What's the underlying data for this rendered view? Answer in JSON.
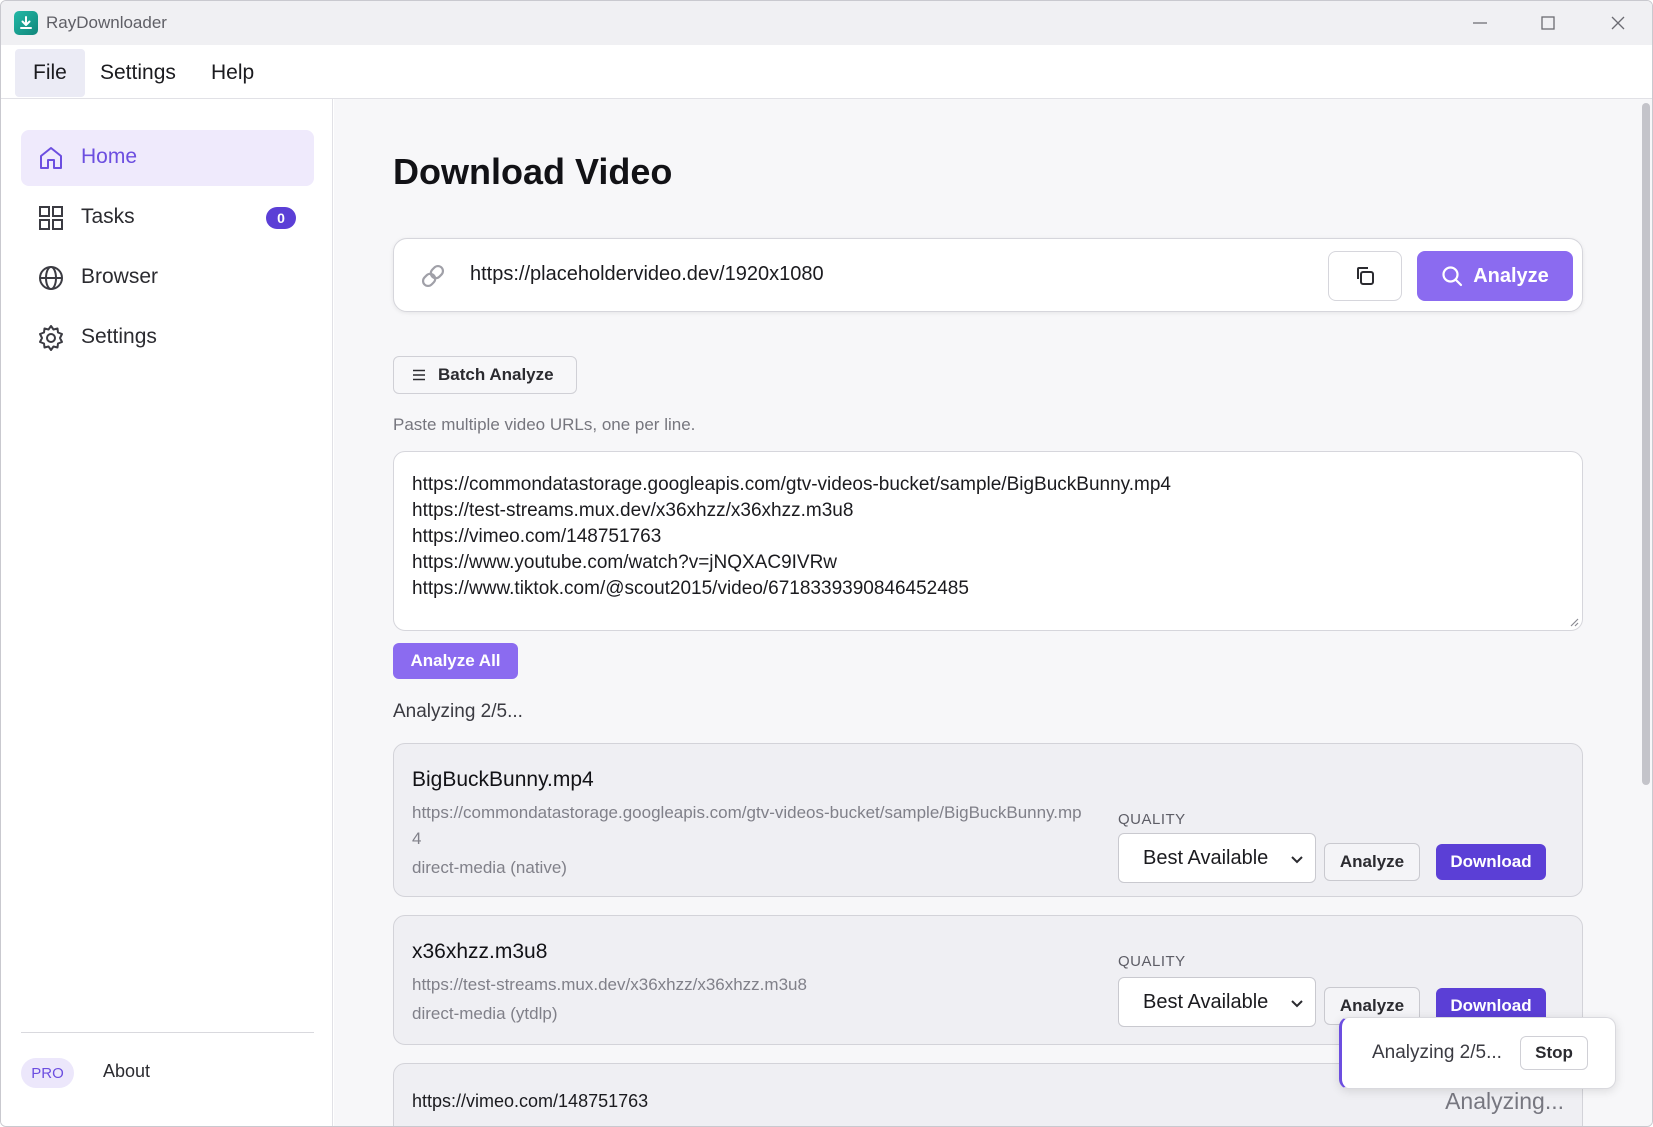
{
  "app": {
    "title": "RayDownloader"
  },
  "menu": {
    "items": [
      {
        "label": "File"
      },
      {
        "label": "Settings"
      },
      {
        "label": "Help"
      }
    ]
  },
  "sidebar": {
    "items": [
      {
        "label": "Home",
        "icon": "home-icon",
        "active": true
      },
      {
        "label": "Tasks",
        "icon": "grid-icon",
        "badge": "0"
      },
      {
        "label": "Browser",
        "icon": "globe-icon"
      },
      {
        "label": "Settings",
        "icon": "gear-icon"
      }
    ],
    "pro_label": "PRO",
    "about_label": "About"
  },
  "main": {
    "title": "Download Video",
    "url_input": {
      "value": "https://placeholdervideo.dev/1920x1080"
    },
    "analyze_label": "Analyze",
    "batch": {
      "button_label": "Batch Analyze",
      "hint": "Paste multiple video URLs, one per line.",
      "urls": [
        "https://commondatastorage.googleapis.com/gtv-videos-bucket/sample/BigBuckBunny.mp4",
        "https://test-streams.mux.dev/x36xhzz/x36xhzz.m3u8",
        "https://vimeo.com/148751763",
        "https://www.youtube.com/watch?v=jNQXAC9IVRw",
        "https://www.tiktok.com/@scout2015/video/6718339390846452485"
      ],
      "analyze_all_label": "Analyze All",
      "status": "Analyzing 2/5..."
    },
    "results": [
      {
        "title": "BigBuckBunny.mp4",
        "url": "https://commondatastorage.googleapis.com/gtv-videos-bucket/sample/BigBuckBunny.mp4",
        "source": "direct-media (native)",
        "quality_label": "QUALITY",
        "quality_value": "Best Available",
        "analyze_label": "Analyze",
        "download_label": "Download"
      },
      {
        "title": "x36xhzz.m3u8",
        "url": "https://test-streams.mux.dev/x36xhzz/x36xhzz.m3u8",
        "source": "direct-media (ytdlp)",
        "quality_label": "QUALITY",
        "quality_value": "Best Available",
        "analyze_label": "Analyze",
        "download_label": "Download"
      },
      {
        "url": "https://vimeo.com/148751763",
        "status": "Analyzing..."
      }
    ]
  },
  "toast": {
    "text": "Analyzing 2/5...",
    "stop_label": "Stop"
  },
  "colors": {
    "accent": "#5b3fd6",
    "accent_light": "#8b6bf0",
    "active_nav_bg": "#efeafc"
  }
}
